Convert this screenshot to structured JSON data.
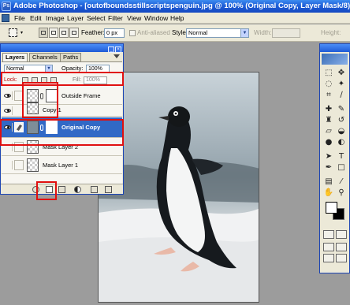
{
  "window": {
    "title": "Adobe Photoshop - [outofboundsstillscriptspenguin.jpg @ 100% (Original Copy, Layer Mask/8)]"
  },
  "menu": [
    "File",
    "Edit",
    "Image",
    "Layer",
    "Select",
    "Filter",
    "View",
    "Window",
    "Help"
  ],
  "options_bar": {
    "feather_label": "Feather:",
    "feather_value": "0 px",
    "anti_aliased_label": "Anti-aliased",
    "style_label": "Style:",
    "style_value": "Normal",
    "width_label": "Width:",
    "height_label": "Height:"
  },
  "layers_palette": {
    "tabs": [
      "Layers",
      "Channels",
      "Paths"
    ],
    "active_tab": "Layers",
    "blend_mode": "Normal",
    "opacity_label": "Opacity:",
    "opacity_value": "100%",
    "lock_label": "Lock:",
    "fill_label": "Fill:",
    "fill_value": "100%",
    "layers": [
      {
        "name": "Outside Frame",
        "visible": true,
        "has_mask": true,
        "selected": false
      },
      {
        "name": "Copy 1",
        "visible": true,
        "has_mask": false,
        "selected": false
      },
      {
        "name": "Original Copy",
        "visible": true,
        "has_mask": true,
        "selected": true
      },
      {
        "name": "Mask Layer 2",
        "visible": false,
        "has_mask": false,
        "selected": false
      },
      {
        "name": "Mask Layer 1",
        "visible": false,
        "has_mask": false,
        "selected": false
      }
    ]
  },
  "highlight_color": "#e01010",
  "selection_color": "#3169c6"
}
